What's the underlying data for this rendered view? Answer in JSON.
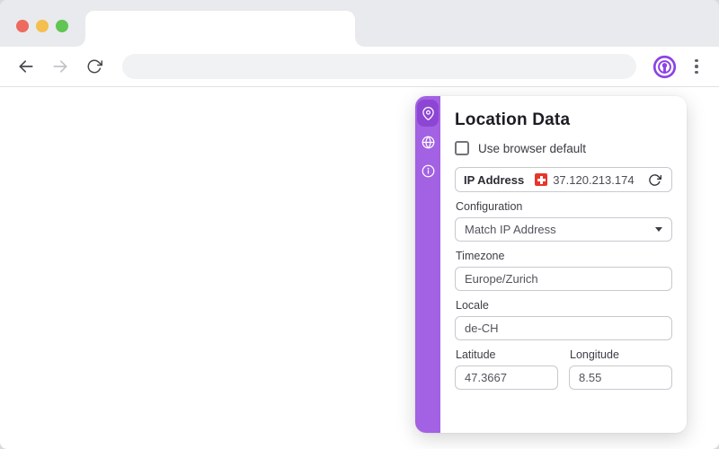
{
  "browser": {
    "tab_title": "",
    "address_bar": {
      "value": "",
      "placeholder": ""
    },
    "toolbar": {
      "back_icon": "back-arrow",
      "forward_icon": "forward-arrow",
      "reload_icon": "reload",
      "extension_icon": "vytal-location-logo",
      "menu_icon": "kebab-menu"
    }
  },
  "popup": {
    "title": "Location Data",
    "use_browser_default": {
      "label": "Use browser default",
      "checked": false
    },
    "ip_address": {
      "label": "IP Address",
      "value": "37.120.213.174",
      "country_flag": "switzerland",
      "refresh_icon": "refresh"
    },
    "configuration": {
      "label": "Configuration",
      "selected": "Match IP Address"
    },
    "timezone": {
      "label": "Timezone",
      "value": "Europe/Zurich"
    },
    "locale": {
      "label": "Locale",
      "value": "de-CH"
    },
    "latitude": {
      "label": "Latitude",
      "value": "47.3667"
    },
    "longitude": {
      "label": "Longitude",
      "value": "8.55"
    },
    "sidebar": {
      "items": [
        {
          "icon": "map-pin-icon",
          "active": true
        },
        {
          "icon": "globe-icon",
          "active": false
        },
        {
          "icon": "info-icon",
          "active": false
        }
      ]
    }
  },
  "colors": {
    "accent_purple": "#8b43e6",
    "sidebar_purple": "#a361e3",
    "sidebar_active_purple": "#8d46d3",
    "swiss_flag_red": "#e8352a",
    "traffic_red": "#ed6a5e",
    "traffic_yellow": "#f4bf4f",
    "traffic_green": "#61c554"
  }
}
